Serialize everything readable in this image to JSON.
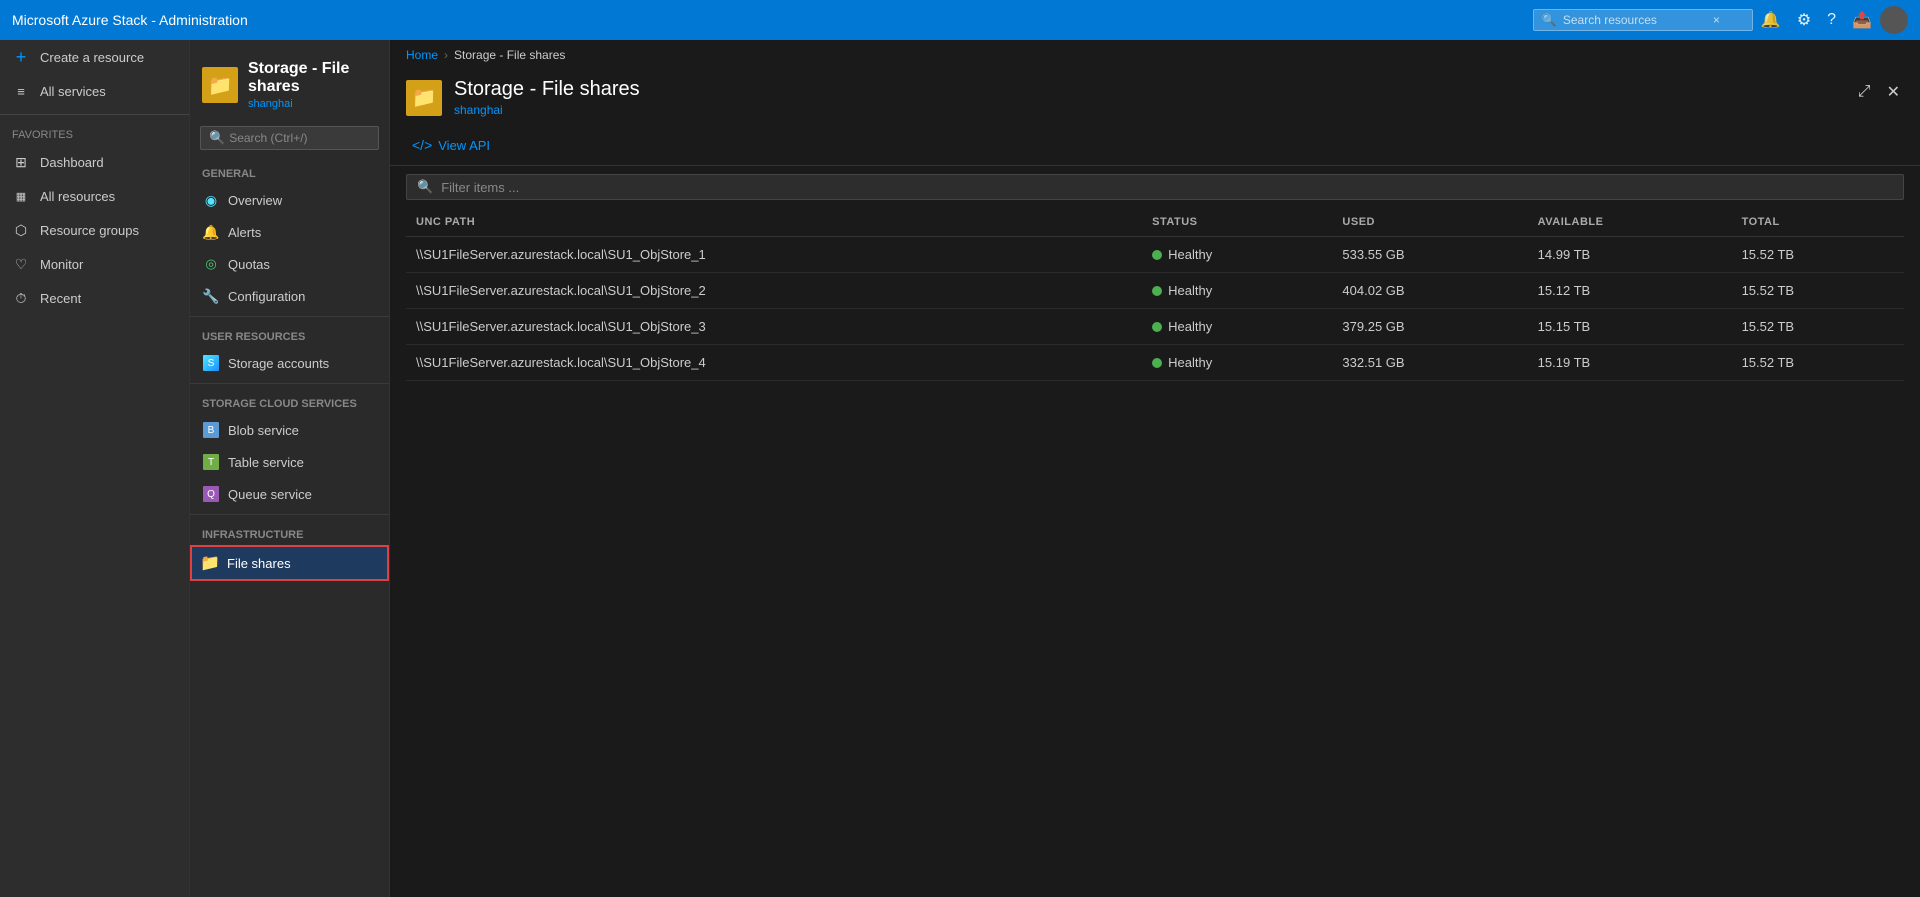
{
  "app": {
    "title": "Microsoft Azure Stack - Administration"
  },
  "topbar": {
    "title": "Microsoft Azure Stack - Administration",
    "search_placeholder": "Search resources",
    "search_clear": "×"
  },
  "sidebar": {
    "create_resource": "Create a resource",
    "all_services": "All services",
    "favorites_label": "FAVORITES",
    "items": [
      {
        "id": "dashboard",
        "label": "Dashboard",
        "icon": "⊞"
      },
      {
        "id": "all-resources",
        "label": "All resources",
        "icon": "⊟"
      },
      {
        "id": "resource-groups",
        "label": "Resource groups",
        "icon": "⬡"
      },
      {
        "id": "monitor",
        "label": "Monitor",
        "icon": "♡"
      },
      {
        "id": "recent",
        "label": "Recent",
        "icon": "⏱"
      }
    ]
  },
  "resource_nav": {
    "title": "Storage - File shares",
    "subtitle": "shanghai",
    "search_placeholder": "Search (Ctrl+/)",
    "sections": [
      {
        "label": "GENERAL",
        "items": [
          {
            "id": "overview",
            "label": "Overview",
            "icon": "overview"
          },
          {
            "id": "alerts",
            "label": "Alerts",
            "icon": "alert"
          },
          {
            "id": "quotas",
            "label": "Quotas",
            "icon": "quota"
          },
          {
            "id": "configuration",
            "label": "Configuration",
            "icon": "config"
          }
        ]
      },
      {
        "label": "USER RESOURCES",
        "items": [
          {
            "id": "storage-accounts",
            "label": "Storage accounts",
            "icon": "storage"
          }
        ]
      },
      {
        "label": "STORAGE CLOUD SERVICES",
        "items": [
          {
            "id": "blob-service",
            "label": "Blob service",
            "icon": "blob"
          },
          {
            "id": "table-service",
            "label": "Table service",
            "icon": "table"
          },
          {
            "id": "queue-service",
            "label": "Queue service",
            "icon": "queue"
          }
        ]
      },
      {
        "label": "INFRASTRUCTURE",
        "items": [
          {
            "id": "file-shares",
            "label": "File shares",
            "icon": "folder",
            "active": true
          }
        ]
      }
    ]
  },
  "breadcrumb": {
    "home": "Home",
    "current": "Storage - File shares"
  },
  "content": {
    "title": "Storage - File shares",
    "subtitle": "shanghai",
    "toolbar": {
      "view_api": "View API"
    },
    "filter_placeholder": "Filter items ...",
    "table": {
      "columns": [
        "UNC PATH",
        "STATUS",
        "USED",
        "AVAILABLE",
        "TOTAL"
      ],
      "rows": [
        {
          "unc_path": "\\\\SU1FileServer.azurestack.local\\SU1_ObjStore_1",
          "status": "Healthy",
          "used": "533.55 GB",
          "available": "14.99 TB",
          "total": "15.52 TB"
        },
        {
          "unc_path": "\\\\SU1FileServer.azurestack.local\\SU1_ObjStore_2",
          "status": "Healthy",
          "used": "404.02 GB",
          "available": "15.12 TB",
          "total": "15.52 TB"
        },
        {
          "unc_path": "\\\\SU1FileServer.azurestack.local\\SU1_ObjStore_3",
          "status": "Healthy",
          "used": "379.25 GB",
          "available": "15.15 TB",
          "total": "15.52 TB"
        },
        {
          "unc_path": "\\\\SU1FileServer.azurestack.local\\SU1_ObjStore_4",
          "status": "Healthy",
          "used": "332.51 GB",
          "available": "15.19 TB",
          "total": "15.52 TB"
        }
      ]
    }
  }
}
